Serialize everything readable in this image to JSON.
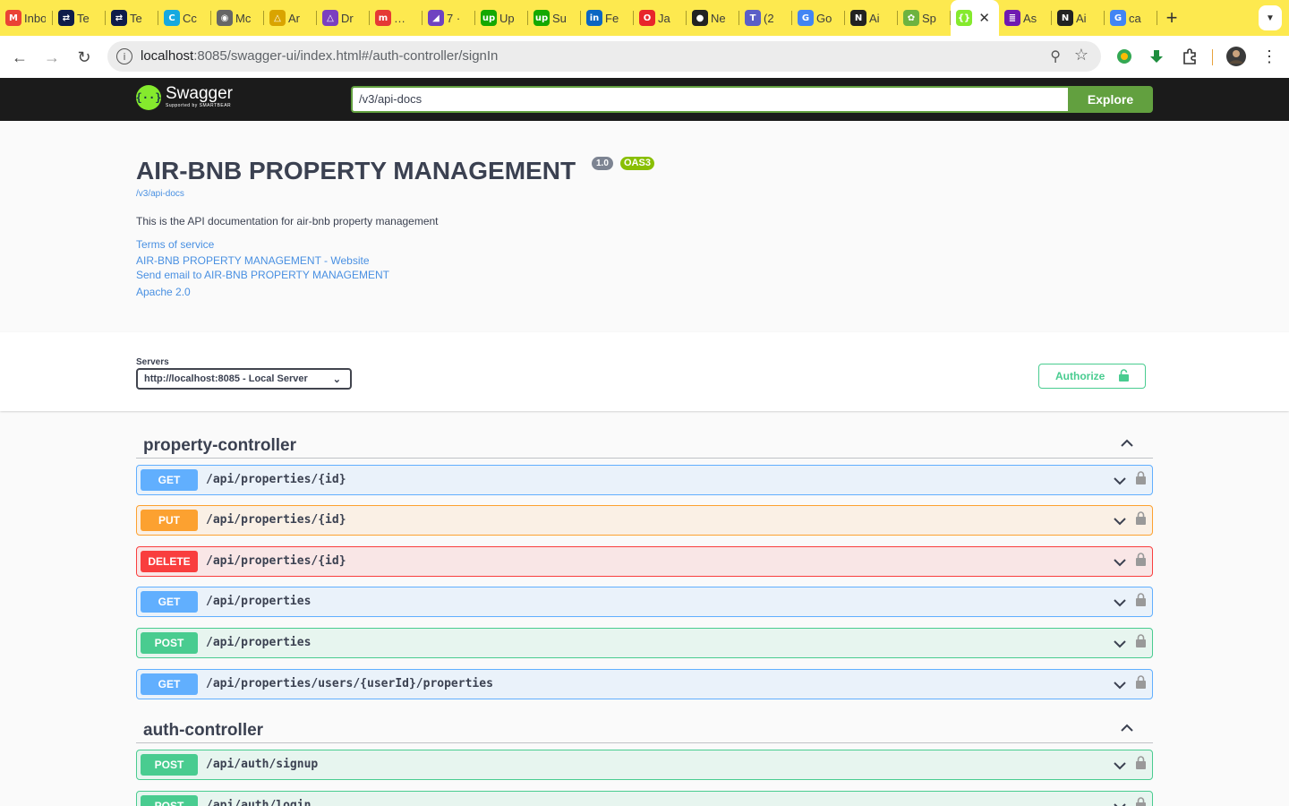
{
  "browser": {
    "tabs": [
      {
        "label": "Inbox",
        "icon": "gmail-icon",
        "icon_text": "M",
        "color": "#ea4335"
      },
      {
        "label": "Te",
        "icon": "teamviewer-icon",
        "icon_text": "⇄",
        "color": "#0e1c4a"
      },
      {
        "label": "Te",
        "icon": "teamviewer-icon",
        "icon_text": "⇄",
        "color": "#0e1c4a"
      },
      {
        "label": "Cc",
        "icon": "cc-icon",
        "icon_text": "C",
        "color": "#16a9e0"
      },
      {
        "label": "Mc",
        "icon": "globe-icon",
        "icon_text": "◉",
        "color": "#666666"
      },
      {
        "label": "Ar",
        "icon": "drive-icon",
        "icon_text": "△",
        "color": "#d9a400"
      },
      {
        "label": "Dr",
        "icon": "drive-icon",
        "icon_text": "△",
        "color": "#7b3fbf"
      },
      {
        "label": "…",
        "icon": "m-icon",
        "icon_text": "m",
        "color": "#e53935"
      },
      {
        "label": "7 ·",
        "icon": "linear-icon",
        "icon_text": "◢",
        "color": "#6f42c1"
      },
      {
        "label": "Up",
        "icon": "upwork-icon",
        "icon_text": "up",
        "color": "#14a800"
      },
      {
        "label": "Su",
        "icon": "upwork-icon",
        "icon_text": "up",
        "color": "#14a800"
      },
      {
        "label": "Fe",
        "icon": "linkedin-icon",
        "icon_text": "in",
        "color": "#0a66c2"
      },
      {
        "label": "Ja",
        "icon": "opera-icon",
        "icon_text": "O",
        "color": "#e8252b"
      },
      {
        "label": "Ne",
        "icon": "github-icon",
        "icon_text": "●",
        "color": "#222222"
      },
      {
        "label": "(2",
        "icon": "teams-icon",
        "icon_text": "T",
        "color": "#5b5fc7"
      },
      {
        "label": "Go",
        "icon": "google-key-icon",
        "icon_text": "G",
        "color": "#4285f4"
      },
      {
        "label": "Ai",
        "icon": "notion-icon",
        "icon_text": "N",
        "color": "#222222"
      },
      {
        "label": "Sp",
        "icon": "spring-icon",
        "icon_text": "✿",
        "color": "#6db33f"
      },
      {
        "label": "",
        "icon": "swagger-icon",
        "icon_text": "{}",
        "color": "#85ea2d",
        "active": true
      },
      {
        "label": "As",
        "icon": "list-icon",
        "icon_text": "≣",
        "color": "#6f1ab1"
      },
      {
        "label": "Ai",
        "icon": "notion-icon",
        "icon_text": "N",
        "color": "#222222"
      },
      {
        "label": "ca",
        "icon": "google-icon",
        "icon_text": "G",
        "color": "#4285f4"
      }
    ],
    "url_host": "localhost",
    "url_rest": ":8085/swagger-ui/index.html#/auth-controller/signIn"
  },
  "swagger": {
    "logo_text": "Swagger",
    "logo_sub": "Supported by SMARTBEAR",
    "spec_url": "/v3/api-docs",
    "explore_label": "Explore"
  },
  "info": {
    "title": "AIR-BNB PROPERTY MANAGEMENT",
    "version": "1.0",
    "oas": "OAS3",
    "spec_link": "/v3/api-docs",
    "description": "This is the API documentation for air-bnb property management",
    "terms": "Terms of service",
    "website": "AIR-BNB PROPERTY MANAGEMENT - Website",
    "email": "Send email to AIR-BNB PROPERTY MANAGEMENT",
    "license": "Apache 2.0"
  },
  "servers": {
    "label": "Servers",
    "selected": "http://localhost:8085 - Local Server",
    "authorize_label": "Authorize"
  },
  "tags": [
    {
      "name": "property-controller",
      "ops": [
        {
          "method": "GET",
          "path": "/api/properties/{id}"
        },
        {
          "method": "PUT",
          "path": "/api/properties/{id}"
        },
        {
          "method": "DELETE",
          "path": "/api/properties/{id}"
        },
        {
          "method": "GET",
          "path": "/api/properties"
        },
        {
          "method": "POST",
          "path": "/api/properties"
        },
        {
          "method": "GET",
          "path": "/api/properties/users/{userId}/properties"
        }
      ]
    },
    {
      "name": "auth-controller",
      "ops": [
        {
          "method": "POST",
          "path": "/api/auth/signup"
        },
        {
          "method": "POST",
          "path": "/api/auth/login"
        }
      ]
    }
  ]
}
